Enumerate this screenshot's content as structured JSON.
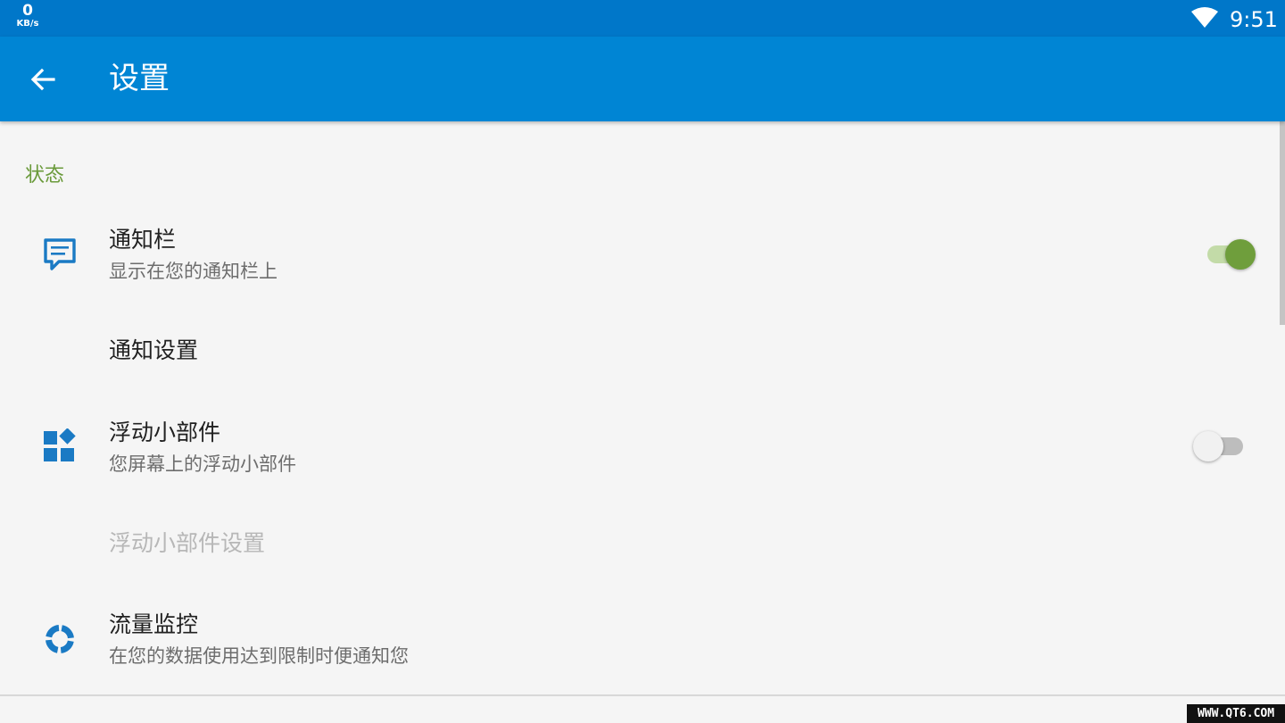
{
  "status_bar": {
    "speed_value": "0",
    "speed_unit": "KB/s",
    "time": "9:51",
    "wifi_icon": "wifi-icon"
  },
  "app_bar": {
    "back_icon": "arrow-back-icon",
    "title": "设置"
  },
  "section": {
    "header": "状态"
  },
  "items": [
    {
      "title": "通知栏",
      "subtitle": "显示在您的通知栏上",
      "icon": "message-icon",
      "toggle": true
    },
    {
      "title": "通知设置"
    },
    {
      "title": "浮动小部件",
      "subtitle": "您屏幕上的浮动小部件",
      "icon": "widgets-icon",
      "toggle": false
    },
    {
      "title": "浮动小部件设置",
      "disabled": true
    },
    {
      "title": "流量监控",
      "subtitle": "在您的数据使用达到限制时便通知您",
      "icon": "data-usage-icon"
    }
  ],
  "colors": {
    "status_bar": "#0077c9",
    "app_bar": "#0085d4",
    "accent_green": "#6f9e3c",
    "icon_blue": "#1a7ac4",
    "section_header": "#6a9a3a"
  },
  "watermark": "WWW.QT6.COM"
}
